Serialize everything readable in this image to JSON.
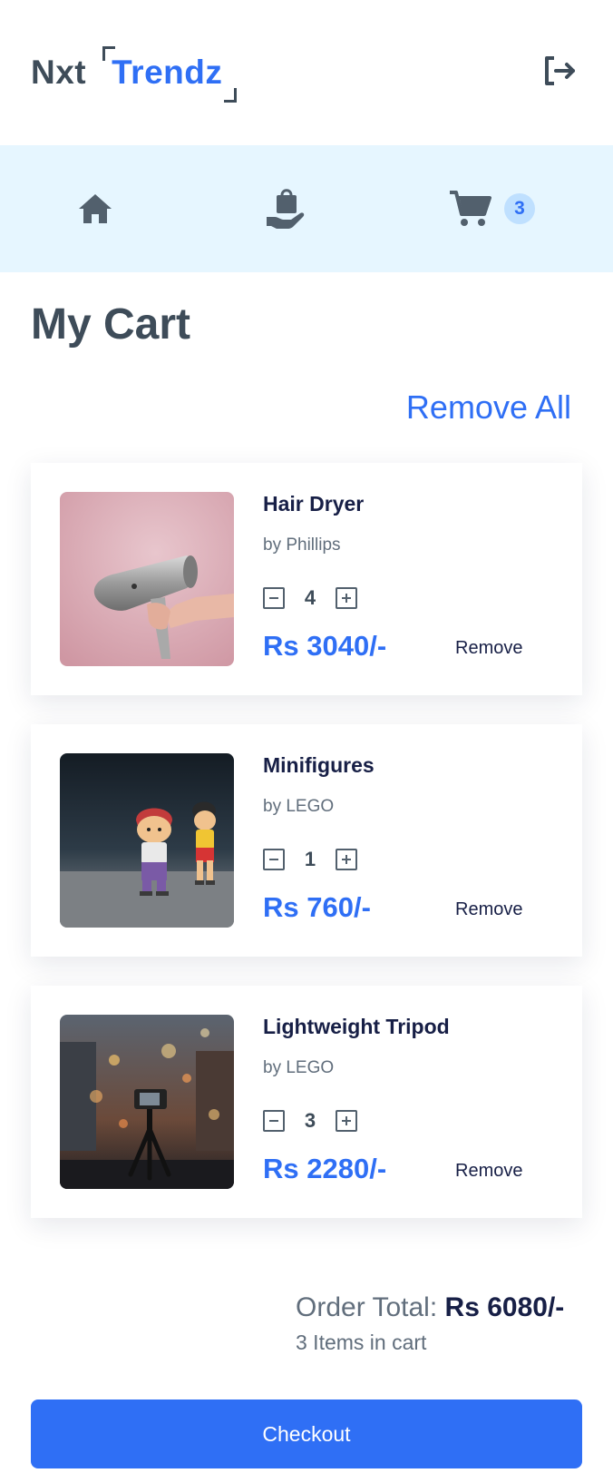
{
  "header": {
    "logo_part1": "Nxt",
    "logo_part2": "Trendz",
    "logout_icon": "logout-icon"
  },
  "nav": {
    "home_icon": "home-icon",
    "products_icon": "shopping-bag-hand-icon",
    "cart_icon": "cart-icon",
    "cart_count": "3"
  },
  "cart": {
    "title": "My Cart",
    "remove_all_label": "Remove All",
    "items": [
      {
        "title": "Hair Dryer",
        "brand": "by Phillips",
        "quantity": "4",
        "price": "Rs 3040/-",
        "remove_label": "Remove"
      },
      {
        "title": "Minifigures",
        "brand": "by LEGO",
        "quantity": "1",
        "price": "Rs 760/-",
        "remove_label": "Remove"
      },
      {
        "title": "Lightweight Tripod",
        "brand": "by LEGO",
        "quantity": "3",
        "price": "Rs 2280/-",
        "remove_label": "Remove"
      }
    ]
  },
  "summary": {
    "order_total_label": "Order Total:",
    "order_total_value": "Rs 6080/-",
    "items_count_text": "3 Items in cart",
    "checkout_label": "Checkout"
  },
  "colors": {
    "accent": "#2f6ff5",
    "nav_background": "#e6f6ff",
    "dark_text": "#171f46",
    "heading_text": "#3e4c59"
  }
}
